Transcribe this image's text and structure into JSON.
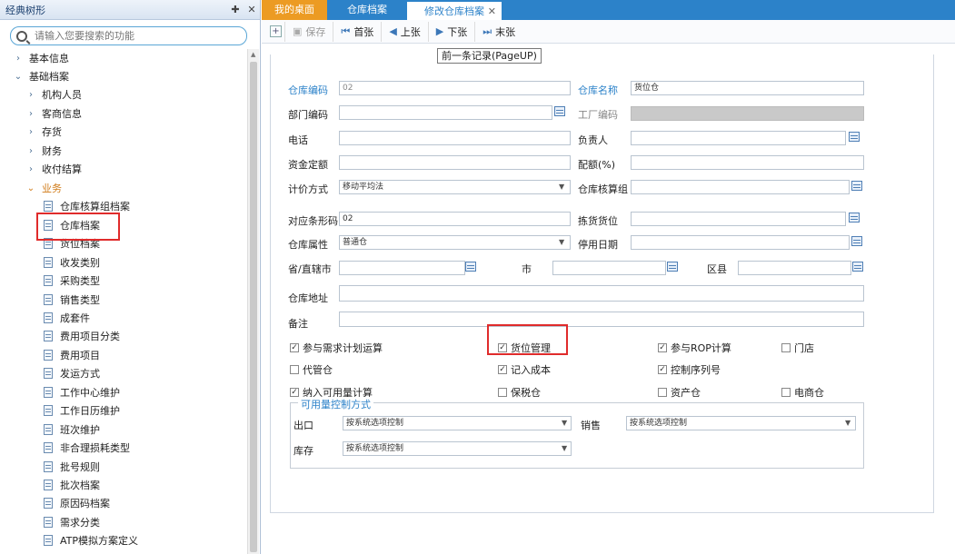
{
  "left_panel": {
    "title": "经典树形",
    "search_placeholder": "请输入您要搜索的功能",
    "tree": [
      {
        "label": "基本信息",
        "level": 0,
        "expanded": false
      },
      {
        "label": "基础档案",
        "level": 0,
        "expanded": true
      },
      {
        "label": "机构人员",
        "level": 1,
        "expanded": false
      },
      {
        "label": "客商信息",
        "level": 1,
        "expanded": false
      },
      {
        "label": "存货",
        "level": 1,
        "expanded": false
      },
      {
        "label": "财务",
        "level": 1,
        "expanded": false
      },
      {
        "label": "收付结算",
        "level": 1,
        "expanded": false
      },
      {
        "label": "业务",
        "level": 1,
        "expanded": true
      },
      {
        "label": "仓库核算组档案",
        "level": 2
      },
      {
        "label": "仓库档案",
        "level": 2
      },
      {
        "label": "货位档案",
        "level": 2
      },
      {
        "label": "收发类别",
        "level": 2
      },
      {
        "label": "采购类型",
        "level": 2
      },
      {
        "label": "销售类型",
        "level": 2
      },
      {
        "label": "成套件",
        "level": 2
      },
      {
        "label": "费用项目分类",
        "level": 2
      },
      {
        "label": "费用项目",
        "level": 2
      },
      {
        "label": "发运方式",
        "level": 2
      },
      {
        "label": "工作中心维护",
        "level": 2
      },
      {
        "label": "工作日历维护",
        "level": 2
      },
      {
        "label": "班次维护",
        "level": 2
      },
      {
        "label": "非合理损耗类型",
        "level": 2
      },
      {
        "label": "批号规则",
        "level": 2
      },
      {
        "label": "批次档案",
        "level": 2
      },
      {
        "label": "原因码档案",
        "level": 2
      },
      {
        "label": "需求分类",
        "level": 2
      },
      {
        "label": "ATP模拟方案定义",
        "level": 2
      }
    ]
  },
  "tabs": [
    {
      "label": "我的桌面"
    },
    {
      "label": "仓库档案"
    },
    {
      "label": "修改仓库档案",
      "active": true
    }
  ],
  "toolbar": {
    "save": "保存",
    "first": "首张",
    "prev": "上张",
    "next": "下张",
    "last": "末张",
    "tooltip": "前一条记录(PageUP)"
  },
  "form": {
    "code_label": "仓库编码",
    "code_value": "02",
    "name_label": "仓库名称",
    "name_value": "货位仓",
    "dept_label": "部门编码",
    "factory_label": "工厂编码",
    "phone_label": "电话",
    "manager_label": "负责人",
    "fund_label": "资金定额",
    "ratio_label": "配额(%)",
    "pricing_label": "计价方式",
    "pricing_value": "移动平均法",
    "calc_group_label": "仓库核算组",
    "barcode_label": "对应条形码",
    "barcode_value": "02",
    "pick_loc_label": "拣货货位",
    "attr_label": "仓库属性",
    "attr_value": "普通仓",
    "stop_date_label": "停用日期",
    "province_label": "省/直辖市",
    "city_label": "市",
    "district_label": "区县",
    "address_label": "仓库地址",
    "note_label": "备注",
    "checkboxes": [
      {
        "label": "参与需求计划运算",
        "checked": true
      },
      {
        "label": "货位管理",
        "checked": true
      },
      {
        "label": "参与ROP计算",
        "checked": true
      },
      {
        "label": "门店",
        "checked": false
      },
      {
        "label": "代管仓",
        "checked": false
      },
      {
        "label": "记入成本",
        "checked": true
      },
      {
        "label": "控制序列号",
        "checked": true
      },
      {
        "label": "纳入可用量计算",
        "checked": true
      },
      {
        "label": "保税仓",
        "checked": false
      },
      {
        "label": "资产仓",
        "checked": false
      },
      {
        "label": "电商仓",
        "checked": false
      }
    ],
    "avail_title": "可用量控制方式",
    "out_label": "出口",
    "out_value": "按系统选项控制",
    "sales_label": "销售",
    "sales_value": "按系统选项控制",
    "stock_label": "库存",
    "stock_value": "按系统选项控制"
  }
}
